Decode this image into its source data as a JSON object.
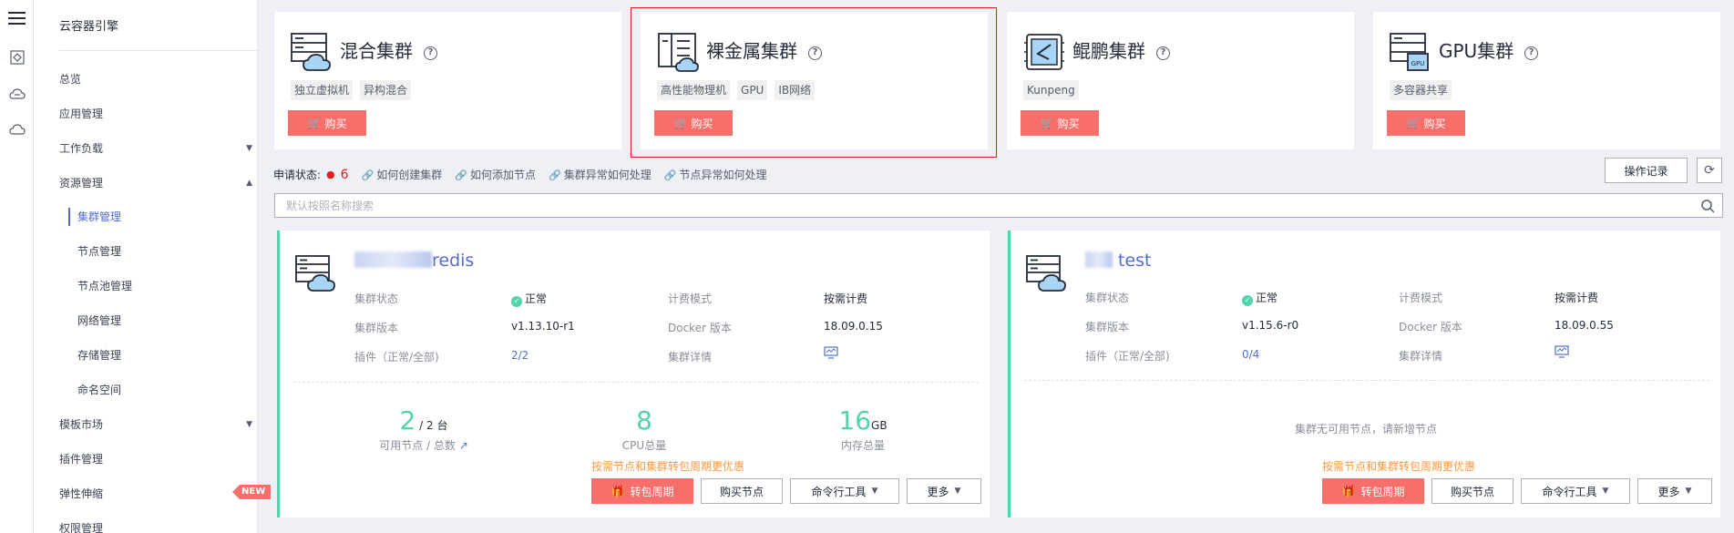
{
  "sidebar": {
    "title": "云容器引擎",
    "items": [
      {
        "label": "总览"
      },
      {
        "label": "应用管理"
      },
      {
        "label": "工作负载"
      },
      {
        "label": "资源管理"
      },
      {
        "label": "集群管理"
      },
      {
        "label": "节点管理"
      },
      {
        "label": "节点池管理"
      },
      {
        "label": "网络管理"
      },
      {
        "label": "存储管理"
      },
      {
        "label": "命名空间"
      },
      {
        "label": "模板市场"
      },
      {
        "label": "插件管理"
      },
      {
        "label": "弹性伸缩",
        "badge": "NEW"
      },
      {
        "label": "权限管理"
      }
    ]
  },
  "products": [
    {
      "title": "混合集群",
      "tags": [
        "独立虚拟机",
        "异构混合"
      ],
      "buy": "购买",
      "icon": "server-cloud-icon"
    },
    {
      "title": "裸金属集群",
      "tags": [
        "高性能物理机",
        "GPU",
        "IB网络"
      ],
      "buy": "购买",
      "icon": "bare-metal-icon"
    },
    {
      "title": "鲲鹏集群",
      "tags": [
        "Kunpeng"
      ],
      "buy": "购买",
      "icon": "kunpeng-chip-icon"
    },
    {
      "title": "GPU集群",
      "tags": [
        "多容器共享"
      ],
      "buy": "购买",
      "icon": "gpu-server-icon"
    }
  ],
  "status": {
    "label": "申请状态:",
    "count": "6",
    "links": [
      "如何创建集群",
      "如何添加节点",
      "集群异常如何处理",
      "节点异常如何处理"
    ]
  },
  "toolbar": {
    "oprecord": "操作记录",
    "refresh": "⟳"
  },
  "search": {
    "placeholder": "默认按照名称搜索"
  },
  "clusters": [
    {
      "name_suffix": "redis",
      "fields": {
        "status_label": "集群状态",
        "status": "正常",
        "billing_label": "计费模式",
        "billing": "按需计费",
        "version_label": "集群版本",
        "version": "v1.13.10-r1",
        "docker_label": "Docker 版本",
        "docker": "18.09.0.15",
        "addons_label": "插件（正常/全部)",
        "addons": "2/2",
        "detail_label": "集群详情"
      },
      "stats": {
        "nodes": "2",
        "nodes_total": "/ 2 台",
        "nodes_caption": "可用节点 / 总数",
        "cpu": "8",
        "cpu_caption": "CPU总量",
        "mem": "16",
        "mem_unit": "GB",
        "mem_caption": "内存总量"
      },
      "promo": "按需节点和集群转包周期更优惠",
      "actions": [
        "转包周期",
        "购买节点",
        "命令行工具",
        "更多"
      ]
    },
    {
      "name_suffix": "test",
      "fields": {
        "status_label": "集群状态",
        "status": "正常",
        "billing_label": "计费模式",
        "billing": "按需计费",
        "version_label": "集群版本",
        "version": "v1.15.6-r0",
        "docker_label": "Docker 版本",
        "docker": "18.09.0.55",
        "addons_label": "插件（正常/全部)",
        "addons": "0/4",
        "detail_label": "集群详情"
      },
      "empty": "集群无可用节点，请新增节点",
      "promo": "按需节点和集群转包周期更优惠",
      "actions": [
        "转包周期",
        "购买节点",
        "命令行工具",
        "更多"
      ]
    }
  ],
  "colors": {
    "accent": "#526ecc",
    "buy": "#f66f6a",
    "ok": "#50d4ab",
    "promo": "#fa9841",
    "highlight": "#e02020"
  }
}
